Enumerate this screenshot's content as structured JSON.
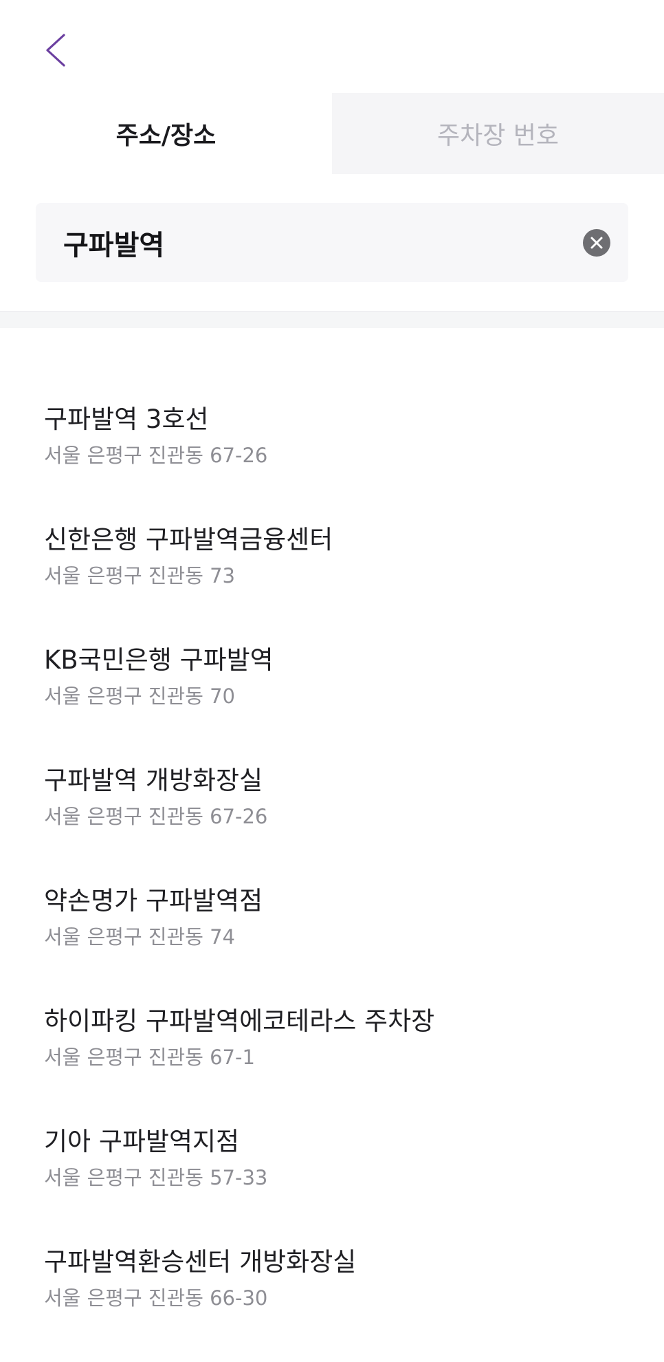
{
  "header": {
    "back_icon": "chevron-left-icon",
    "accent_color": "#6b3fa0"
  },
  "tabs": [
    {
      "label": "주소/장소",
      "active": true
    },
    {
      "label": "주차장 번호",
      "active": false
    }
  ],
  "search": {
    "value": "구파발역",
    "clear_icon": "clear-circle-icon"
  },
  "results": [
    {
      "name": "구파발역 3호선",
      "address": "서울 은평구 진관동 67-26"
    },
    {
      "name": "신한은행 구파발역금융센터",
      "address": "서울 은평구 진관동 73"
    },
    {
      "name": "KB국민은행 구파발역",
      "address": "서울 은평구 진관동 70"
    },
    {
      "name": "구파발역 개방화장실",
      "address": "서울 은평구 진관동 67-26"
    },
    {
      "name": "약손명가 구파발역점",
      "address": "서울 은평구 진관동 74"
    },
    {
      "name": "하이파킹 구파발역에코테라스 주차장",
      "address": "서울 은평구 진관동 67-1"
    },
    {
      "name": "기아 구파발역지점",
      "address": "서울 은평구 진관동 57-33"
    },
    {
      "name": "구파발역환승센터 개방화장실",
      "address": "서울 은평구 진관동 66-30"
    }
  ]
}
